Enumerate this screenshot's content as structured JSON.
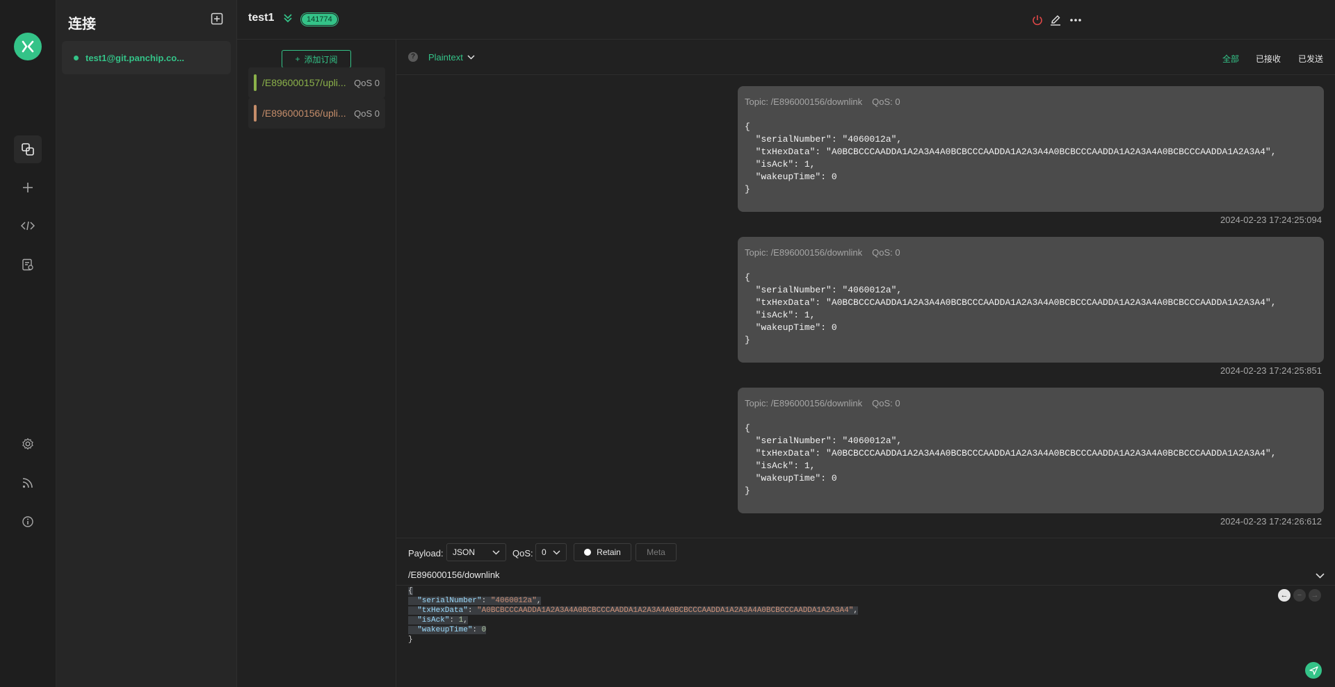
{
  "sidebar": {
    "icons": [
      "logo-icon",
      "connections-icon",
      "new-connection-icon",
      "script-icon",
      "log-icon",
      "settings-icon",
      "feed-icon",
      "about-icon"
    ]
  },
  "connections": {
    "title": "连接",
    "items": [
      {
        "name": "test1@git.panchip.co...",
        "status_color": "#34c388"
      }
    ]
  },
  "header": {
    "connection_name": "test1",
    "message_count": "141774"
  },
  "subscriptions": {
    "add_label": "添加订阅",
    "items": [
      {
        "topic": "/E896000157/upli...",
        "qos": "QoS 0",
        "color": "#8bb14a"
      },
      {
        "topic": "/E896000156/upli...",
        "qos": "QoS 0",
        "color": "#c58d6a"
      }
    ]
  },
  "message_toolbar": {
    "format": "Plaintext",
    "filters": {
      "all": "全部",
      "received": "已接收",
      "sent": "已发送"
    }
  },
  "messages": [
    {
      "topic": "Topic: /E896000156/downlink",
      "qos": "QoS: 0",
      "payload": "{\n  \"serialNumber\": \"4060012a\",\n  \"txHexData\": \"A0BCBCCCAADDA1A2A3A4A0BCBCCCAADDA1A2A3A4A0BCBCCCAADDA1A2A3A4A0BCBCCCAADDA1A2A3A4\",\n  \"isAck\": 1,\n  \"wakeupTime\": 0\n}",
      "time": "2024-02-23 17:24:25:094"
    },
    {
      "topic": "Topic: /E896000156/downlink",
      "qos": "QoS: 0",
      "payload": "{\n  \"serialNumber\": \"4060012a\",\n  \"txHexData\": \"A0BCBCCCAADDA1A2A3A4A0BCBCCCAADDA1A2A3A4A0BCBCCCAADDA1A2A3A4A0BCBCCCAADDA1A2A3A4\",\n  \"isAck\": 1,\n  \"wakeupTime\": 0\n}",
      "time": "2024-02-23 17:24:25:851"
    },
    {
      "topic": "Topic: /E896000156/downlink",
      "qos": "QoS: 0",
      "payload": "{\n  \"serialNumber\": \"4060012a\",\n  \"txHexData\": \"A0BCBCCCAADDA1A2A3A4A0BCBCCCAADDA1A2A3A4A0BCBCCCAADDA1A2A3A4A0BCBCCCAADDA1A2A3A4\",\n  \"isAck\": 1,\n  \"wakeupTime\": 0\n}",
      "time": "2024-02-23 17:24:26:612"
    }
  ],
  "publish": {
    "payload_label": "Payload:",
    "payload_format": "JSON",
    "qos_label": "QoS:",
    "qos_value": "0",
    "retain_label": "Retain",
    "meta_label": "Meta",
    "topic": "/E896000156/downlink",
    "editor": {
      "open_brace": "{",
      "k1": "\"serialNumber\"",
      "v1": "\"4060012a\"",
      "k2": "\"txHexData\"",
      "v2": "\"A0BCBCCCAADDA1A2A3A4A0BCBCCCAADDA1A2A3A4A0BCBCCCAADDA1A2A3A4A0BCBCCCAADDA1A2A3A4\"",
      "k3": "\"isAck\"",
      "v3": "1",
      "k4": "\"wakeupTime\"",
      "v4": "0",
      "close_brace": "}"
    }
  },
  "colors": {
    "accent": "#34c388",
    "card": "#4b4b4b",
    "disconnect": "#e04848"
  }
}
